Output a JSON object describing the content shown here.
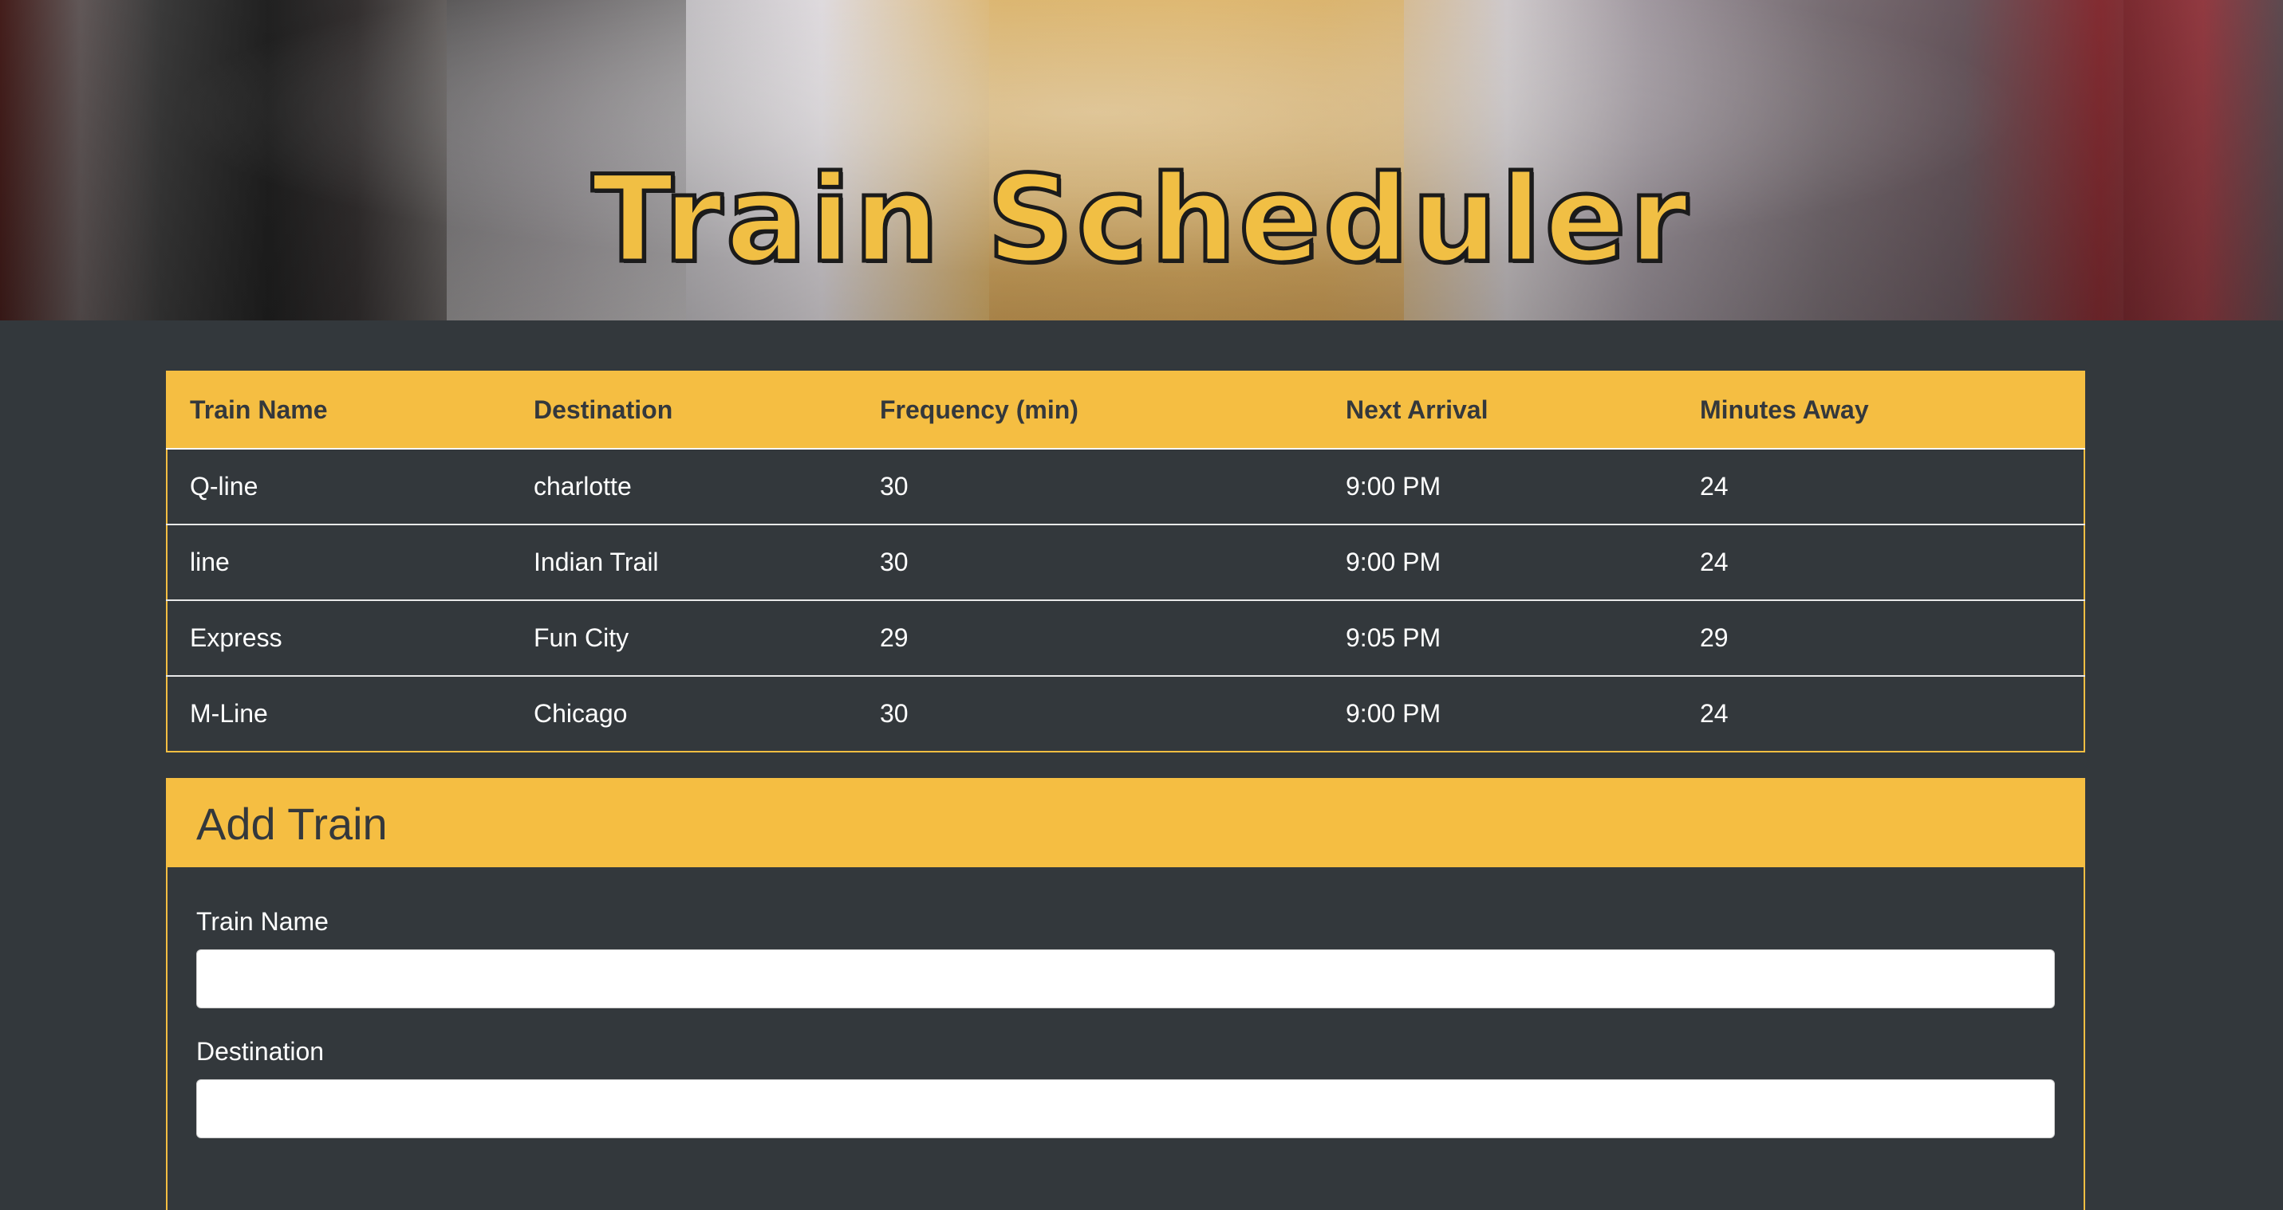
{
  "header": {
    "title": "Train Scheduler"
  },
  "schedule": {
    "columns": [
      "Train Name",
      "Destination",
      "Frequency (min)",
      "Next Arrival",
      "Minutes Away"
    ],
    "rows": [
      [
        "Q-line",
        "charlotte",
        "30",
        "9:00 PM",
        "24"
      ],
      [
        "line",
        "Indian Trail",
        "30",
        "9:00 PM",
        "24"
      ],
      [
        "Express",
        "Fun City",
        "29",
        "9:05 PM",
        "29"
      ],
      [
        "M-Line",
        "Chicago",
        "30",
        "9:00 PM",
        "24"
      ]
    ]
  },
  "add_train": {
    "heading": "Add Train",
    "fields": [
      {
        "label": "Train Name",
        "value": ""
      },
      {
        "label": "Destination",
        "value": ""
      }
    ]
  },
  "colors": {
    "accent": "#f5be42",
    "background": "#33383c"
  }
}
